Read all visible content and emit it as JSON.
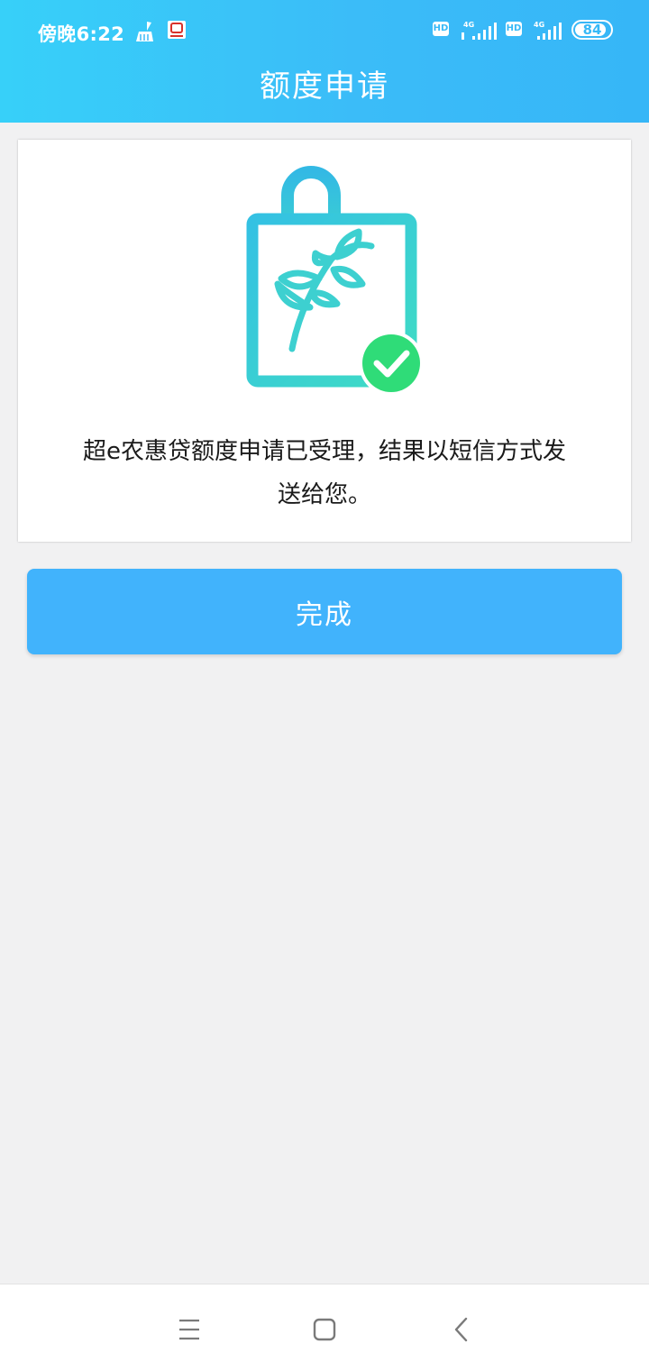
{
  "status_bar": {
    "time": "傍晚6:22",
    "battery": "84",
    "network_label": "4G",
    "hd_label": "HD"
  },
  "header": {
    "title": "额度申请"
  },
  "result_card": {
    "message": "超e农惠贷额度申请已受理，结果以短信方式发送给您。"
  },
  "actions": {
    "done_label": "完成"
  },
  "theme": {
    "header_gradient_start": "#37d0f9",
    "header_gradient_end": "#36b6f7",
    "button_color": "#41b3fc",
    "check_green": "#2fdc78"
  },
  "icons": {
    "illustration": "shopping-bag-leaf-with-check",
    "nav_menu": "menu-icon",
    "nav_home": "home-icon",
    "nav_back": "back-icon"
  }
}
